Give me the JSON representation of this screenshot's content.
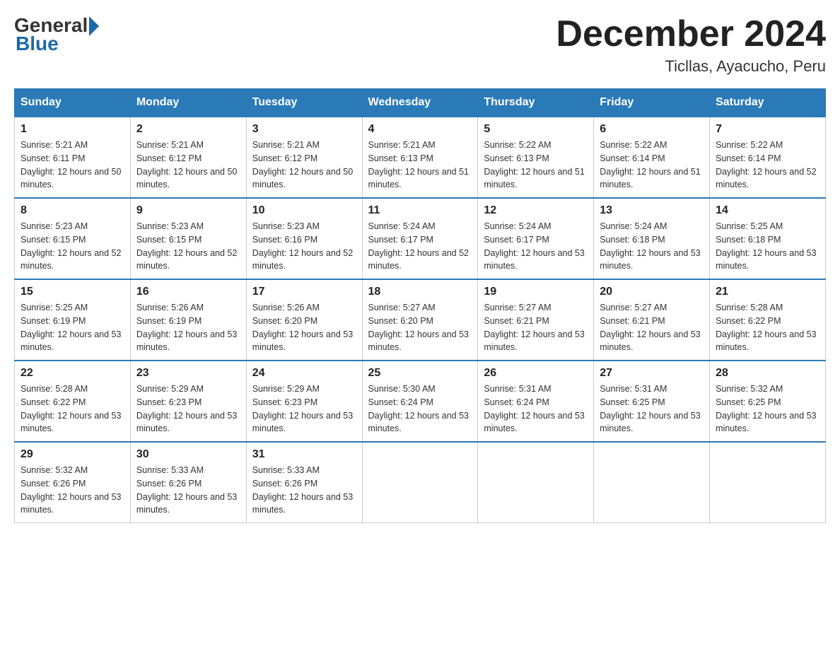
{
  "logo": {
    "general": "General",
    "blue": "Blue"
  },
  "title": "December 2024",
  "location": "Ticllas, Ayacucho, Peru",
  "days_of_week": [
    "Sunday",
    "Monday",
    "Tuesday",
    "Wednesday",
    "Thursday",
    "Friday",
    "Saturday"
  ],
  "weeks": [
    [
      {
        "day": "1",
        "sunrise": "5:21 AM",
        "sunset": "6:11 PM",
        "daylight": "12 hours and 50 minutes."
      },
      {
        "day": "2",
        "sunrise": "5:21 AM",
        "sunset": "6:12 PM",
        "daylight": "12 hours and 50 minutes."
      },
      {
        "day": "3",
        "sunrise": "5:21 AM",
        "sunset": "6:12 PM",
        "daylight": "12 hours and 50 minutes."
      },
      {
        "day": "4",
        "sunrise": "5:21 AM",
        "sunset": "6:13 PM",
        "daylight": "12 hours and 51 minutes."
      },
      {
        "day": "5",
        "sunrise": "5:22 AM",
        "sunset": "6:13 PM",
        "daylight": "12 hours and 51 minutes."
      },
      {
        "day": "6",
        "sunrise": "5:22 AM",
        "sunset": "6:14 PM",
        "daylight": "12 hours and 51 minutes."
      },
      {
        "day": "7",
        "sunrise": "5:22 AM",
        "sunset": "6:14 PM",
        "daylight": "12 hours and 52 minutes."
      }
    ],
    [
      {
        "day": "8",
        "sunrise": "5:23 AM",
        "sunset": "6:15 PM",
        "daylight": "12 hours and 52 minutes."
      },
      {
        "day": "9",
        "sunrise": "5:23 AM",
        "sunset": "6:15 PM",
        "daylight": "12 hours and 52 minutes."
      },
      {
        "day": "10",
        "sunrise": "5:23 AM",
        "sunset": "6:16 PM",
        "daylight": "12 hours and 52 minutes."
      },
      {
        "day": "11",
        "sunrise": "5:24 AM",
        "sunset": "6:17 PM",
        "daylight": "12 hours and 52 minutes."
      },
      {
        "day": "12",
        "sunrise": "5:24 AM",
        "sunset": "6:17 PM",
        "daylight": "12 hours and 53 minutes."
      },
      {
        "day": "13",
        "sunrise": "5:24 AM",
        "sunset": "6:18 PM",
        "daylight": "12 hours and 53 minutes."
      },
      {
        "day": "14",
        "sunrise": "5:25 AM",
        "sunset": "6:18 PM",
        "daylight": "12 hours and 53 minutes."
      }
    ],
    [
      {
        "day": "15",
        "sunrise": "5:25 AM",
        "sunset": "6:19 PM",
        "daylight": "12 hours and 53 minutes."
      },
      {
        "day": "16",
        "sunrise": "5:26 AM",
        "sunset": "6:19 PM",
        "daylight": "12 hours and 53 minutes."
      },
      {
        "day": "17",
        "sunrise": "5:26 AM",
        "sunset": "6:20 PM",
        "daylight": "12 hours and 53 minutes."
      },
      {
        "day": "18",
        "sunrise": "5:27 AM",
        "sunset": "6:20 PM",
        "daylight": "12 hours and 53 minutes."
      },
      {
        "day": "19",
        "sunrise": "5:27 AM",
        "sunset": "6:21 PM",
        "daylight": "12 hours and 53 minutes."
      },
      {
        "day": "20",
        "sunrise": "5:27 AM",
        "sunset": "6:21 PM",
        "daylight": "12 hours and 53 minutes."
      },
      {
        "day": "21",
        "sunrise": "5:28 AM",
        "sunset": "6:22 PM",
        "daylight": "12 hours and 53 minutes."
      }
    ],
    [
      {
        "day": "22",
        "sunrise": "5:28 AM",
        "sunset": "6:22 PM",
        "daylight": "12 hours and 53 minutes."
      },
      {
        "day": "23",
        "sunrise": "5:29 AM",
        "sunset": "6:23 PM",
        "daylight": "12 hours and 53 minutes."
      },
      {
        "day": "24",
        "sunrise": "5:29 AM",
        "sunset": "6:23 PM",
        "daylight": "12 hours and 53 minutes."
      },
      {
        "day": "25",
        "sunrise": "5:30 AM",
        "sunset": "6:24 PM",
        "daylight": "12 hours and 53 minutes."
      },
      {
        "day": "26",
        "sunrise": "5:31 AM",
        "sunset": "6:24 PM",
        "daylight": "12 hours and 53 minutes."
      },
      {
        "day": "27",
        "sunrise": "5:31 AM",
        "sunset": "6:25 PM",
        "daylight": "12 hours and 53 minutes."
      },
      {
        "day": "28",
        "sunrise": "5:32 AM",
        "sunset": "6:25 PM",
        "daylight": "12 hours and 53 minutes."
      }
    ],
    [
      {
        "day": "29",
        "sunrise": "5:32 AM",
        "sunset": "6:26 PM",
        "daylight": "12 hours and 53 minutes."
      },
      {
        "day": "30",
        "sunrise": "5:33 AM",
        "sunset": "6:26 PM",
        "daylight": "12 hours and 53 minutes."
      },
      {
        "day": "31",
        "sunrise": "5:33 AM",
        "sunset": "6:26 PM",
        "daylight": "12 hours and 53 minutes."
      },
      null,
      null,
      null,
      null
    ]
  ]
}
